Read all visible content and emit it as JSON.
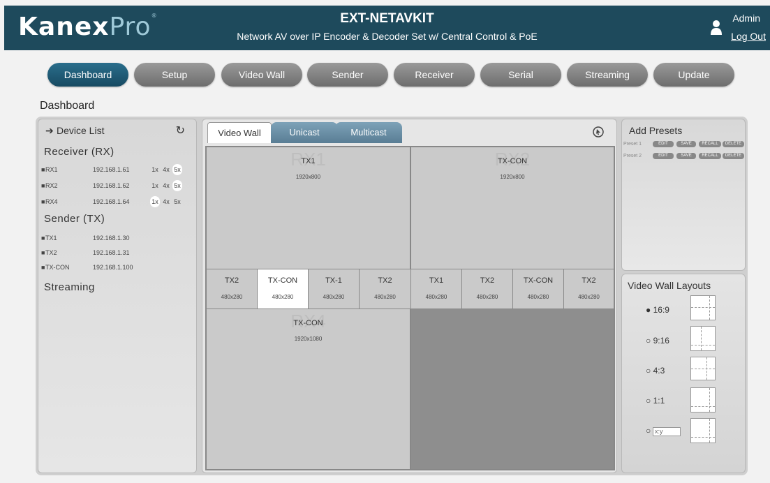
{
  "header": {
    "logo_bold": "Kanex",
    "logo_light": "Pro",
    "title": "EXT-NETAVKIT",
    "subtitle": "Network AV over IP Encoder & Decoder Set w/ Central Control & PoE",
    "user": "Admin",
    "logout": "Log Out"
  },
  "nav": [
    "Dashboard",
    "Setup",
    "Video Wall",
    "Sender",
    "Receiver",
    "Serial",
    "Streaming",
    "Update"
  ],
  "page_title": "Dashboard",
  "device_list": {
    "title": "Device List",
    "receiver_heading": "Receiver (RX)",
    "receivers": [
      {
        "name": "RX1",
        "ip": "192.168.1.61",
        "zoom": [
          "1x",
          "4x",
          "5x"
        ],
        "selected": "5x"
      },
      {
        "name": "RX2",
        "ip": "192.168.1.62",
        "zoom": [
          "1x",
          "4x",
          "5x"
        ],
        "selected": "5x"
      },
      {
        "name": "RX4",
        "ip": "192.168.1.64",
        "zoom": [
          "1x",
          "4x",
          "5x"
        ],
        "selected": "1x"
      }
    ],
    "sender_heading": "Sender (TX)",
    "senders": [
      {
        "name": "TX1",
        "ip": "192.168.1.30"
      },
      {
        "name": "TX2",
        "ip": "192.168.1.31"
      },
      {
        "name": "TX-CON",
        "ip": "192.168.1.100"
      }
    ],
    "streaming_heading": "Streaming"
  },
  "tabs": {
    "video_wall": "Video Wall",
    "unicast": "Unicast",
    "multicast": "Multicast"
  },
  "wall": {
    "rx1": {
      "ghost": "RX1",
      "source": "TX1",
      "res": "1920x800"
    },
    "rx2": {
      "ghost": "RX2",
      "source": "TX-CON",
      "res": "1920x800"
    },
    "rx4": {
      "ghost": "RX4",
      "source": "TX-CON",
      "res": "1920x1080"
    },
    "strip": [
      {
        "source": "TX2",
        "res": "480x280"
      },
      {
        "source": "TX-CON",
        "res": "480x280"
      },
      {
        "source": "TX-1",
        "res": "480x280"
      },
      {
        "source": "TX2",
        "res": "480x280"
      },
      {
        "source": "TX1",
        "res": "480x280"
      },
      {
        "source": "TX2",
        "res": "480x280"
      },
      {
        "source": "TX-CON",
        "res": "480x280"
      },
      {
        "source": "TX2",
        "res": "480x280"
      }
    ]
  },
  "presets": {
    "title": "Add Presets",
    "rows": [
      {
        "label": "Preset 1",
        "buttons": [
          "EDIT",
          "SAVE",
          "RECALL",
          "DELETE"
        ]
      },
      {
        "label": "Preset 2",
        "buttons": [
          "EDIT",
          "SAVE",
          "RECALL",
          "DELETE"
        ]
      }
    ]
  },
  "layouts": {
    "title": "Video Wall Layouts",
    "options": [
      "16:9",
      "9:16",
      "4:3",
      "1:1"
    ],
    "selected": "16:9",
    "custom_placeholder": "x:y"
  }
}
